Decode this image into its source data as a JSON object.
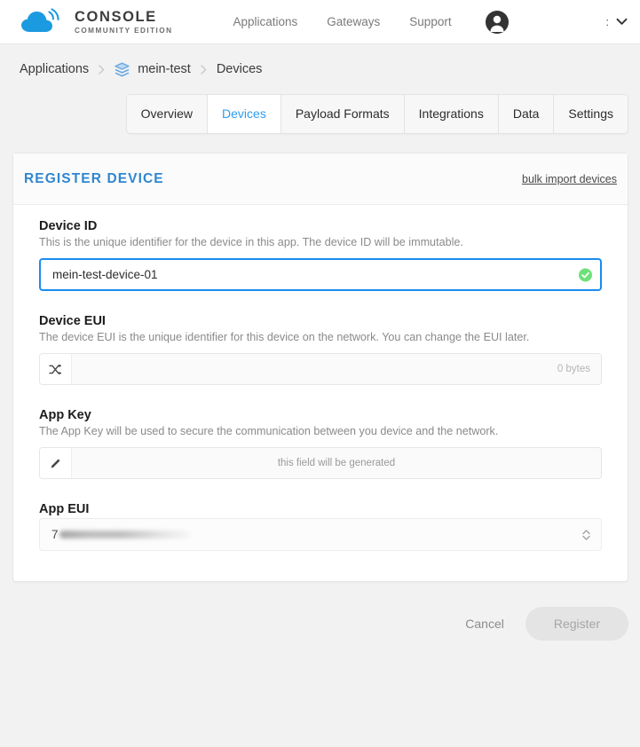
{
  "navbar": {
    "brand_title": "CONSOLE",
    "brand_subtitle": "COMMUNITY EDITION",
    "logo_icon": "cloud-signal-icon",
    "links": [
      {
        "label": "Applications",
        "name": "nav-link-applications"
      },
      {
        "label": "Gateways",
        "name": "nav-link-gateways"
      },
      {
        "label": "Support",
        "name": "nav-link-support"
      }
    ],
    "avatar_icon": "user-avatar-icon",
    "user_label": ":",
    "chevron_icon": "chevron-down-icon"
  },
  "breadcrumb": {
    "items": [
      {
        "label": "Applications",
        "icon": null
      },
      {
        "label": "mein-test",
        "icon": "layers-icon"
      },
      {
        "label": "Devices",
        "icon": null
      }
    ],
    "separator_icon": "chevron-right-icon"
  },
  "tabs": [
    {
      "label": "Overview",
      "active": false
    },
    {
      "label": "Devices",
      "active": true
    },
    {
      "label": "Payload Formats",
      "active": false
    },
    {
      "label": "Integrations",
      "active": false
    },
    {
      "label": "Data",
      "active": false
    },
    {
      "label": "Settings",
      "active": false
    }
  ],
  "card": {
    "title": "REGISTER DEVICE",
    "bulk_import_label": "bulk import devices"
  },
  "form": {
    "device_id": {
      "label": "Device ID",
      "description": "This is the unique identifier for the device in this app. The device ID will be immutable.",
      "value": "mein-test-device-01",
      "placeholder": "",
      "valid_icon": "check-circle-icon",
      "focused": true
    },
    "device_eui": {
      "label": "Device EUI",
      "description": "The device EUI is the unique identifier for this device on the network. You can change the EUI later.",
      "value": "",
      "placeholder": "",
      "addon_icon": "shuffle-icon",
      "byte_count": "0 bytes"
    },
    "app_key": {
      "label": "App Key",
      "description": "The App Key will be used to secure the communication between you device and the network.",
      "addon_icon": "pencil-icon",
      "generated_note": "this field will be generated"
    },
    "app_eui": {
      "label": "App EUI",
      "value_prefix": "7",
      "value_redacted": true,
      "chevron_icon": "chevron-up-down-icon"
    }
  },
  "footer": {
    "cancel_label": "Cancel",
    "register_label": "Register",
    "register_disabled": true
  },
  "colors": {
    "brand_blue": "#2f86d0",
    "accent_blue": "#1a8cf0",
    "active_tab_text": "#2f9bec",
    "valid_green": "#6ee07a",
    "page_bg": "#f2f2f2"
  }
}
